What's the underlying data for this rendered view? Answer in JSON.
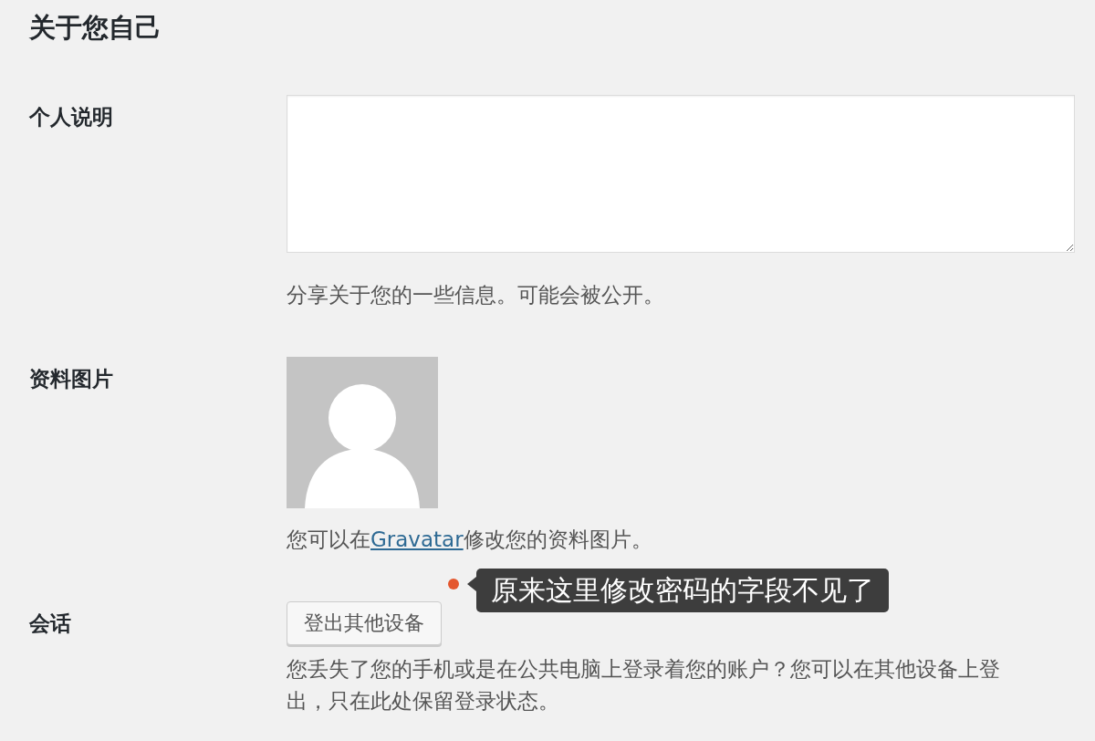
{
  "section_title": "关于您自己",
  "fields": [
    {
      "kind": "textarea",
      "label": "个人说明",
      "description": "分享关于您的一些信息。可能会被公开。"
    },
    {
      "kind": "avatar",
      "label": "资料图片",
      "description": {
        "before": "您可以在",
        "link": "Gravatar",
        "after": "修改您的资料图片。"
      }
    },
    {
      "kind": "button",
      "label": "会话",
      "button": "登出其他设备",
      "annotation": "原来这里修改密码的字段不见了",
      "description": "您丢失了您的手机或是在公共电脑上登录着您的账户？您可以在其他设备上登出，只在此处保留登录状态。"
    }
  ]
}
